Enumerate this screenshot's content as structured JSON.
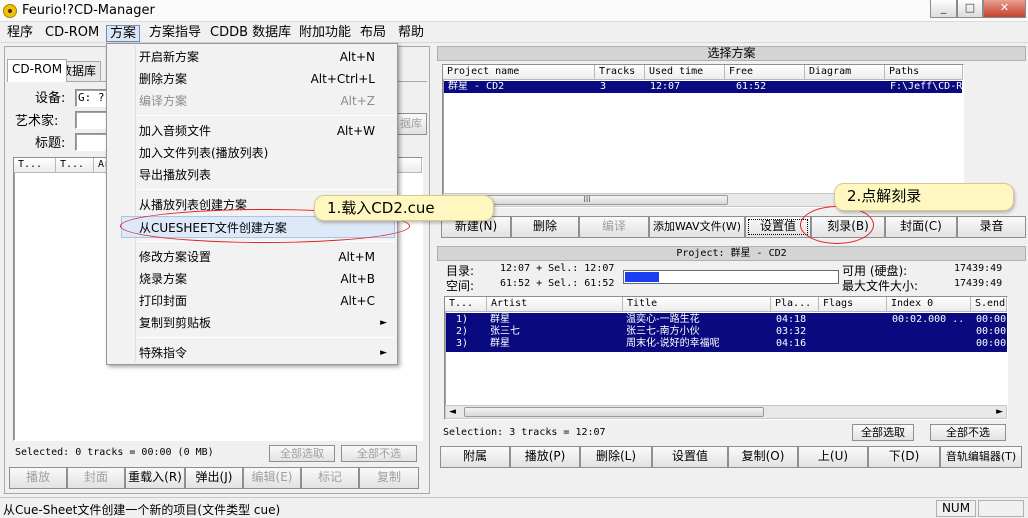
{
  "window": {
    "title": "Feurio!?CD-Manager",
    "controls": {
      "minimize": "_",
      "maximize": "□",
      "close": "✕"
    }
  },
  "menubar": [
    "程序",
    "CD-ROM",
    "方案",
    "方案指导",
    "CDDB 数据库",
    "附加功能",
    "布局",
    "帮助"
  ],
  "dropdown": {
    "items": [
      {
        "label": "开启新方案",
        "shortcut": "Alt+N"
      },
      {
        "label": "删除方案",
        "shortcut": "Alt+Ctrl+L"
      },
      {
        "label": "编译方案",
        "shortcut": "Alt+Z"
      },
      {
        "label": "加入音频文件",
        "shortcut": "Alt+W"
      },
      {
        "label": "加入文件列表(播放列表)"
      },
      {
        "label": "导出播放列表"
      },
      {
        "label": "从播放列表创建方案"
      },
      {
        "label": "从CUESHEET文件创建方案"
      },
      {
        "label": "修改方案设置",
        "shortcut": "Alt+M"
      },
      {
        "label": "烧录方案",
        "shortcut": "Alt+B"
      },
      {
        "label": "打印封面",
        "shortcut": "Alt+C"
      },
      {
        "label": "复制到剪贴板",
        "arrow": "►"
      },
      {
        "label": "特殊指令",
        "arrow": "►"
      }
    ]
  },
  "left_panel": {
    "tabs": [
      "CD-ROM",
      "数据库"
    ],
    "fields": {
      "device_label": "设备:",
      "device_value": "G:  ?",
      "artist_label": "艺术家:",
      "title_label": "标题:"
    },
    "db_button": "据库",
    "columns": [
      "T...",
      "T...",
      "Ar"
    ],
    "selected_text": "Selected: 0 tracks = 00:00 (0 MB)",
    "select_all": "全部选取",
    "deselect_all": "全部不选",
    "buttons": [
      "播放",
      "封面",
      "重载入(R)",
      "弹出(J)",
      "编辑(E)",
      "标记",
      "复制"
    ]
  },
  "project_panel": {
    "caption": "选择方案",
    "columns": [
      "Project name",
      "Tracks",
      "Used time",
      "Free",
      "Diagram",
      "Paths"
    ],
    "rows": [
      {
        "name": "群星 - CD2",
        "tracks": "3",
        "used": "12:07",
        "free": "61:52",
        "diagram": "",
        "path": "F:\\Jeff\\CD-R"
      }
    ],
    "scroll_grip": "III",
    "buttons": [
      "新建(N)",
      "删除",
      "编译",
      "添加WAV文件(W)",
      "设置值",
      "刻录(B)",
      "封面(C)",
      "录音"
    ]
  },
  "track_panel": {
    "caption": "Project: 群星 - CD2",
    "dir_label": "目录:",
    "dir_value": "12:07 + Sel.:  12:07",
    "space_label": "空间:",
    "space_value": "61:52 + Sel.:  61:52",
    "avail_label": "可用 (硬盘):",
    "avail_value": "17439:49",
    "maxfile_label": "最大文件大小:",
    "maxfile_value": "17439:49",
    "usage_fraction": 0.16,
    "columns": [
      "T...",
      "Artist",
      "Title",
      "Pla...",
      "Flags",
      "Index 0",
      "S.end"
    ],
    "rows": [
      {
        "no": "1)",
        "artist": "群星",
        "title": "温奕心-一路生花",
        "time": "04:18",
        "flags": "",
        "index0": "00:02.000  ..",
        "send": "00:00"
      },
      {
        "no": "2)",
        "artist": "张三七",
        "title": "张三七-南方小伙",
        "time": "03:32",
        "flags": "",
        "index0": "",
        "send": "00:00"
      },
      {
        "no": "3)",
        "artist": "群星",
        "title": "周末化-说好的幸福呢",
        "time": "04:16",
        "flags": "",
        "index0": "",
        "send": "00:00"
      }
    ],
    "selection_text": "Selection: 3 tracks = 12:07",
    "select_all": "全部选取",
    "deselect_all": "全部不选",
    "buttons": [
      "附属",
      "播放(P)",
      "删除(L)",
      "设置值",
      "复制(O)",
      "上(U)",
      "下(D)",
      "音轨编辑器(T)"
    ]
  },
  "callouts": {
    "one": "1.载入CD2.cue",
    "two": "2.点解刻录"
  },
  "statusbar": {
    "text": "从Cue-Sheet文件创建一个新的项目(文件类型 cue)",
    "num": "NUM"
  },
  "colors": {
    "selection": "#0a0a80",
    "callout_bg": "#fef8c0",
    "ring": "#e02020"
  }
}
